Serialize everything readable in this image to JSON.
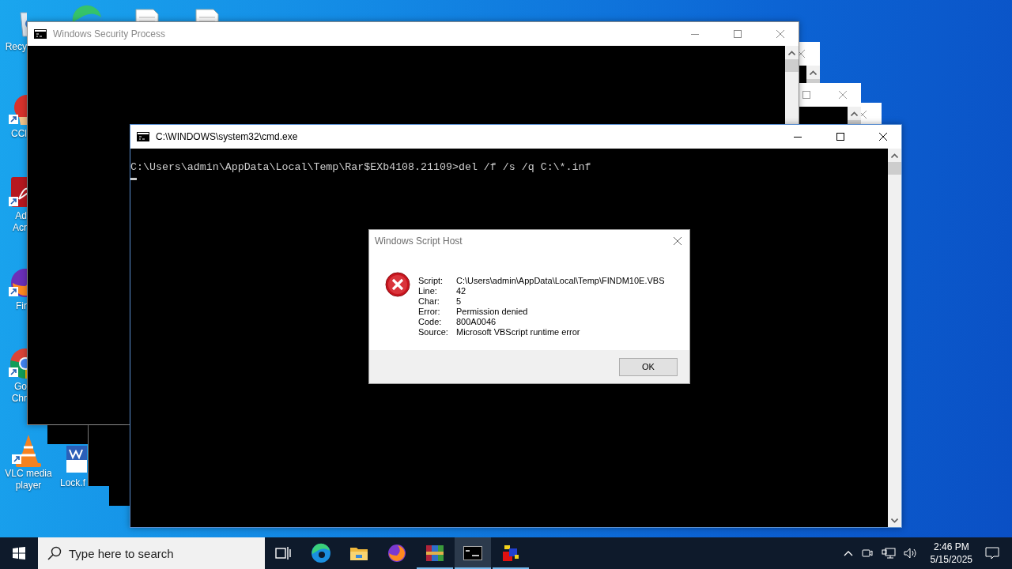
{
  "desktop_icons": [
    {
      "kind": "recycle-bin",
      "shortcut": false,
      "label": [
        "Recy"
      ]
    },
    {
      "kind": "edge"
    },
    {
      "kind": "file"
    },
    {
      "kind": "file"
    },
    {
      "kind": "cleaner",
      "shortcut": true,
      "label": [
        "CCl"
      ]
    },
    {
      "kind": "pdf",
      "shortcut": true,
      "label": [
        "Ad",
        "Acr"
      ]
    },
    {
      "kind": "firefox",
      "shortcut": true,
      "label": [
        "Fir"
      ]
    },
    {
      "kind": "chrome",
      "shortcut": true,
      "label": [
        "Go",
        "Chr"
      ]
    },
    {
      "kind": "vlc",
      "shortcut": true,
      "label": [
        "VLC media",
        "player"
      ]
    },
    {
      "kind": "word",
      "shortcut": false,
      "label": [
        "Lock.f"
      ]
    }
  ],
  "security_window": {
    "title": "Windows Security Process"
  },
  "cmd_window": {
    "title": "C:\\WINDOWS\\system32\\cmd.exe",
    "lines": [
      "C:\\Users\\admin\\AppData\\Local\\Temp\\Rar$EXb4108.21109>del /f /s /q C:\\*.inf"
    ],
    "cursor": true
  },
  "dialog": {
    "title": "Windows Script Host",
    "fields": [
      {
        "label": "Script:",
        "value": "C:\\Users\\admin\\AppData\\Local\\Temp\\FINDM10E.VBS"
      },
      {
        "label": "Line:",
        "value": "42"
      },
      {
        "label": "Char:",
        "value": "5"
      },
      {
        "label": "Error:",
        "value": "Permission denied"
      },
      {
        "label": "Code:",
        "value": "800A0046"
      },
      {
        "label": "Source:",
        "value": "Microsoft VBScript runtime error"
      }
    ],
    "buttons": [
      "OK"
    ]
  },
  "taskbar": {
    "search": {
      "placeholder": "Type here to search"
    },
    "apps": [
      {
        "kind": "task-view",
        "running": false,
        "selected": false
      },
      {
        "kind": "edge",
        "running": false,
        "selected": false
      },
      {
        "kind": "explorer",
        "running": false,
        "selected": false
      },
      {
        "kind": "firefox",
        "running": false,
        "selected": false
      },
      {
        "kind": "winrar",
        "running": true,
        "selected": false
      },
      {
        "kind": "cmd",
        "running": true,
        "selected": true
      },
      {
        "kind": "cubes",
        "running": true,
        "selected": false
      }
    ],
    "tray": {
      "time": "2:46 PM",
      "date": "5/15/2025"
    }
  }
}
